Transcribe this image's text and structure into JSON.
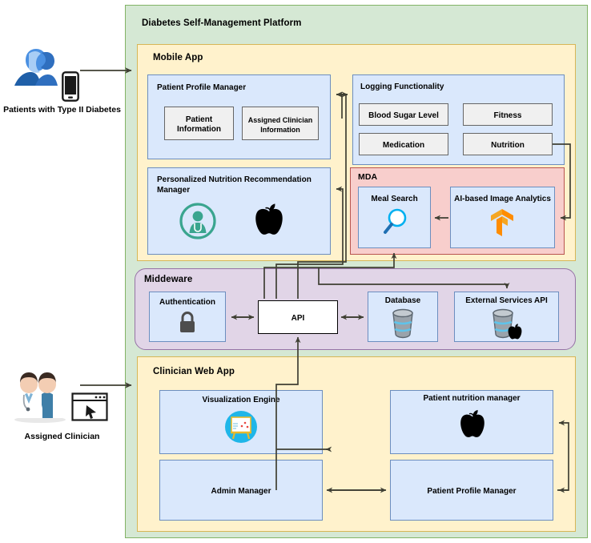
{
  "diagram": {
    "title": "Diabetes Self-Management Platform",
    "type": "architecture-block-diagram"
  },
  "actors": [
    {
      "id": "patients",
      "label": "Patients with Type II Diabetes",
      "icons": [
        "people-group-icon",
        "smartphone-icon"
      ]
    },
    {
      "id": "clinician",
      "label": "Assigned Clinician",
      "icons": [
        "clinicians-icon",
        "browser-window-cursor-icon"
      ]
    }
  ],
  "platform": {
    "title": "Diabetes Self-Management Platform",
    "color": "#d5e8d4",
    "border": "#82b366"
  },
  "mobile_app": {
    "title": "Mobile App",
    "color": "#fff2cc",
    "border": "#d6b656",
    "patient_profile_manager": {
      "title": "Patient Profile Manager",
      "items": [
        {
          "label": "Patient Information"
        },
        {
          "label": "Assigned Clinician Information"
        }
      ]
    },
    "logging_functionality": {
      "title": "Logging Functionality",
      "items": [
        {
          "label": "Blood Sugar Level"
        },
        {
          "label": "Fitness"
        },
        {
          "label": "Medication"
        },
        {
          "label": "Nutrition"
        }
      ]
    },
    "nutrition_recommendation": {
      "title": "Personalized Nutrition Recommendation Manager",
      "icons": [
        "clinician-badge-icon",
        "apple-icon"
      ]
    },
    "mda": {
      "title": "MDA",
      "color": "#f8cecc",
      "border": "#b85450",
      "items": [
        {
          "label": "Meal Search",
          "icon": "magnifier-icon"
        },
        {
          "label": "AI-based Image Analytics",
          "icon": "tensorflow-icon"
        }
      ]
    }
  },
  "middleware": {
    "title": "Middeware",
    "color": "#e1d5e7",
    "border": "#9673a6",
    "items": [
      {
        "label": "Authentication",
        "icon": "padlock-icon"
      },
      {
        "label": "API",
        "icon": ""
      },
      {
        "label": "Database",
        "icon": "database-icon"
      },
      {
        "label": "External Services API",
        "icon": "database-apple-icon"
      }
    ]
  },
  "clinician_web_app": {
    "title": "Clinician Web App",
    "color": "#fff2cc",
    "border": "#d6b656",
    "items": [
      {
        "label": "Visualization Engine",
        "icon": "chart-easel-icon"
      },
      {
        "label": "Patient nutrition manager",
        "icon": "apple-icon"
      },
      {
        "label": "Admin Manager",
        "icon": ""
      },
      {
        "label": "Patient Profile Manager",
        "icon": ""
      }
    ]
  },
  "connections": [
    {
      "from": "patients",
      "to": "mobile-app",
      "style": "single"
    },
    {
      "from": "patient-profile-manager",
      "to": "logging-functionality",
      "style": "double"
    },
    {
      "from": "api",
      "to": "patient-profile-manager",
      "style": "single"
    },
    {
      "from": "api",
      "to": "personalized-nutrition-recommendation-manager",
      "style": "single"
    },
    {
      "from": "nutrition",
      "to": "ai-based-image-analytics",
      "style": "single"
    },
    {
      "from": "ai-based-image-analytics",
      "to": "meal-search",
      "style": "single"
    },
    {
      "from": "meal-search",
      "to": "api",
      "style": "single"
    },
    {
      "from": "authentication",
      "to": "api",
      "style": "double"
    },
    {
      "from": "api",
      "to": "database",
      "style": "double"
    },
    {
      "from": "database",
      "to": "external-services-api",
      "style": "double"
    },
    {
      "from": "logging-functionality",
      "to": "external-services-api",
      "style": "single"
    },
    {
      "from": "clinician",
      "to": "clinician-web-app",
      "style": "single"
    },
    {
      "from": "clinician-web-app",
      "to": "api",
      "style": "single"
    },
    {
      "from": "admin-manager",
      "to": "patient-profile-manager-web",
      "style": "double"
    },
    {
      "from": "patient-profile-manager-web",
      "to": "patient-nutrition-manager",
      "style": "single"
    }
  ]
}
